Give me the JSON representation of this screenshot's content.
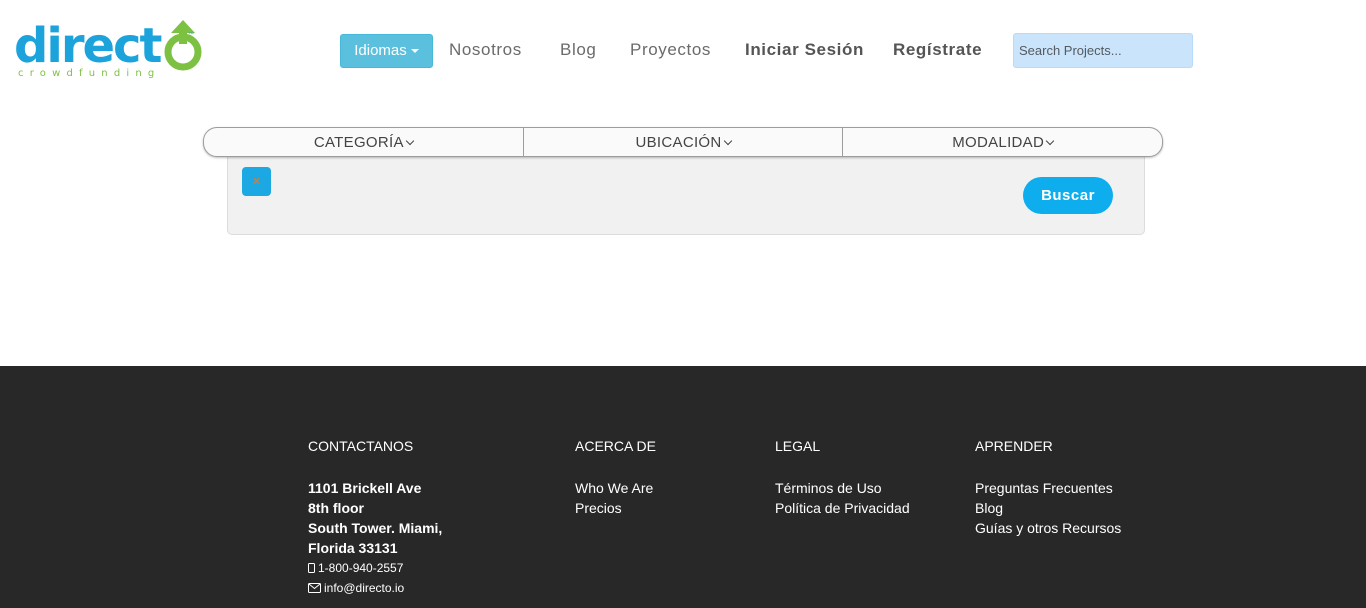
{
  "logo": {
    "word": "direct",
    "subtitle": "crowdfunding",
    "tm": "™"
  },
  "nav": {
    "languages_label": "Idiomas",
    "links": [
      "Nosotros",
      "Blog",
      "Proyectos"
    ],
    "login": "Iniciar Sesión",
    "register": "Regístrate",
    "search_placeholder": "Search Projects..."
  },
  "filters": {
    "items": [
      "CATEGORÍA",
      "UBICACIÓN",
      "MODALIDAD"
    ],
    "clear_symbol": "×",
    "search_button": "Buscar"
  },
  "footer": {
    "contact": {
      "heading": "CONTACTANOS",
      "address": [
        "1101 Brickell Ave",
        "8th floor",
        "South Tower. Miami,",
        "Florida 33131"
      ],
      "phone": "1-800-940-2557",
      "email": "info@directo.io"
    },
    "about": {
      "heading": "ACERCA DE",
      "links": [
        "Who We Are",
        "Precios"
      ]
    },
    "legal": {
      "heading": "LEGAL",
      "links": [
        "Términos de Uso",
        "Política de Privacidad"
      ]
    },
    "learn": {
      "heading": "APRENDER",
      "links": [
        "Preguntas Frecuentes",
        "Blog",
        "Guías y otros Recursos"
      ]
    }
  },
  "colors": {
    "brand_blue": "#1ca3db",
    "brand_green": "#7dc142",
    "button_blue": "#0dadee",
    "footer_bg": "#282828"
  }
}
